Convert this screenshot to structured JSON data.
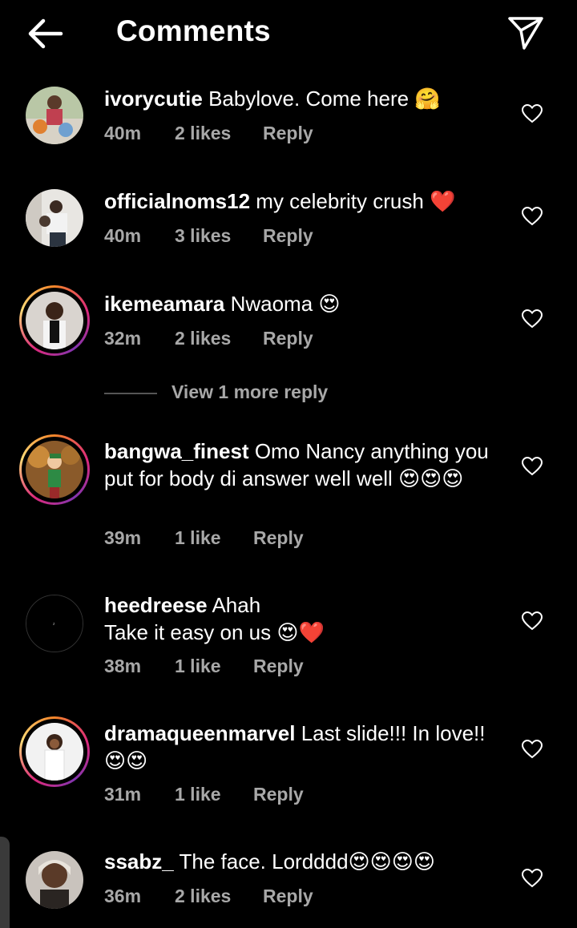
{
  "header": {
    "title": "Comments",
    "back_icon": "arrow-left-icon",
    "share_icon": "paper-plane-icon"
  },
  "comments": [
    {
      "username": "ivorycutie",
      "text": "Babylove. Come here",
      "emoji": "🤗",
      "time": "40m",
      "likes": "2 likes",
      "reply": "Reply"
    },
    {
      "username": "officialnoms12",
      "text": "my celebrity crush",
      "emoji": "❤️",
      "time": "40m",
      "likes": "3 likes",
      "reply": "Reply"
    },
    {
      "username": "ikemeamara",
      "text": "Nwaoma",
      "emoji": "😍",
      "time": "32m",
      "likes": "2 likes",
      "reply": "Reply"
    },
    {
      "username": "bangwa_finest",
      "text": "Omo Nancy anything you put for body di answer well well",
      "emoji": "😍😍😍",
      "time": "39m",
      "likes": "1 like",
      "reply": "Reply"
    },
    {
      "username": "heedreese",
      "text": "Ahah",
      "text2": "Take it easy on us",
      "emoji": "😍❤️",
      "time": "38m",
      "likes": "1 like",
      "reply": "Reply"
    },
    {
      "username": "dramaqueenmarvel",
      "text": "Last slide!!! In love!!",
      "emoji": "😍😍",
      "time": "31m",
      "likes": "1 like",
      "reply": "Reply"
    },
    {
      "username": "ssabz_",
      "text": "The face. Lordddd",
      "emoji": "😍😍😍😍",
      "time": "36m",
      "likes": "2 likes",
      "reply": "Reply"
    }
  ],
  "view_more_reply": "View 1 more reply",
  "colors": {
    "background": "#000000",
    "text": "#ffffff",
    "secondary": "#a8a8a8"
  }
}
